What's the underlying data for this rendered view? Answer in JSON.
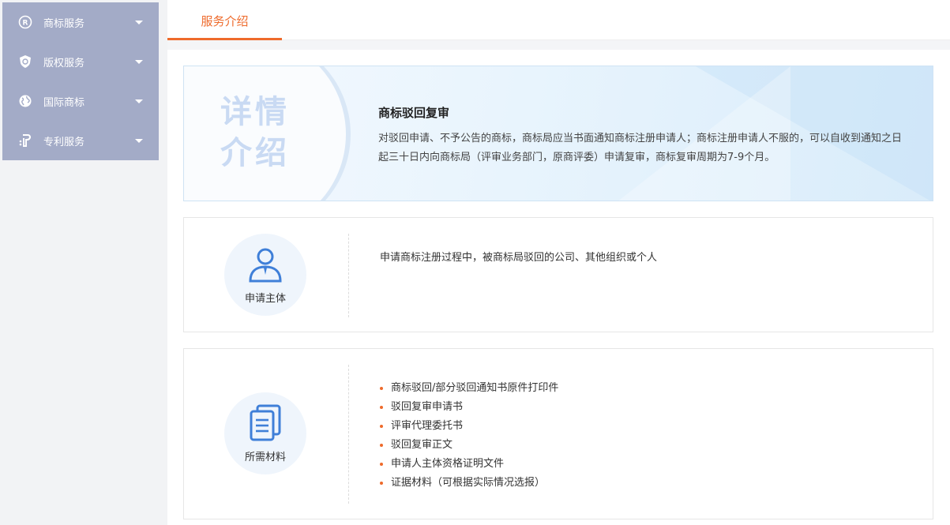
{
  "sidebar": {
    "items": [
      {
        "label": "商标服务",
        "icon": "registered-trademark-icon"
      },
      {
        "label": "版权服务",
        "icon": "copyright-shield-icon"
      },
      {
        "label": "国际商标",
        "icon": "globe-icon"
      },
      {
        "label": "专利服务",
        "icon": "patent-icon"
      }
    ]
  },
  "tabs": [
    {
      "label": "服务介绍",
      "active": true
    }
  ],
  "intro": {
    "big_text": "详情介绍",
    "title": "商标驳回复审",
    "description": "对驳回申请、不予公告的商标，商标局应当书面通知商标注册申请人；商标注册申请人不服的，可以自收到通知之日起三十日内向商标局（评审业务部门，原商评委）申请复审，商标复审周期为7-9个月。"
  },
  "subject": {
    "badge_label": "申请主体",
    "icon": "person-icon",
    "text": "申请商标注册过程中，被商标局驳回的公司、其他组织或个人"
  },
  "materials": {
    "badge_label": "所需材料",
    "icon": "documents-icon",
    "items": [
      "商标驳回/部分驳回通知书原件打印件",
      "驳回复审申请书",
      "评审代理委托书",
      "驳回复审正文",
      "申请人主体资格证明文件",
      "证据材料（可根据实际情况选报）"
    ]
  },
  "colors": {
    "accent": "#ee6a2b",
    "sidebar_bg": "#a3abc7",
    "icon_blue": "#3f7fd8"
  }
}
